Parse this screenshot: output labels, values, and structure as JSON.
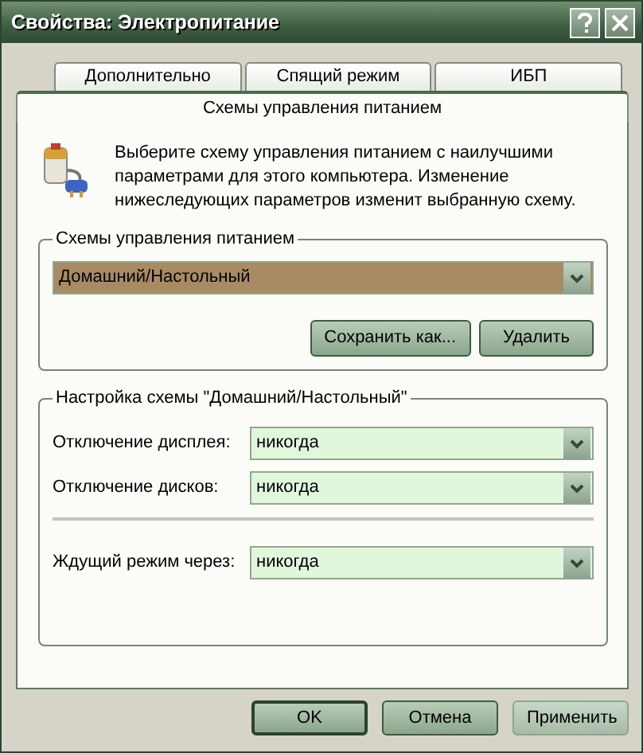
{
  "window": {
    "title": "Свойства: Электропитание",
    "buttons": [
      {
        "kind": "help"
      },
      {
        "kind": "close"
      }
    ]
  },
  "tab_rows": [
    [
      {
        "label": "Дополнительно",
        "selected": false
      },
      {
        "label": "Спящий режим",
        "selected": false
      },
      {
        "label": "ИБП",
        "selected": false
      }
    ],
    [
      {
        "label": "Схемы управления питанием",
        "selected": true
      }
    ]
  ],
  "intro": "Выберите схему управления питанием с наилучшими параметрами для этого компьютера. Изменение нижеследующих параметров изменит выбранную схему.",
  "schemes_group": {
    "title": "Схемы управления питанием",
    "dropdown": {
      "value": "Домашний/Настольный",
      "focused": true
    },
    "buttons": [
      "Сохранить как...",
      "Удалить"
    ]
  },
  "settings_group": {
    "title": "Настройка схемы \"Домашний/Настольный\"",
    "rows": [
      {
        "kind": "field",
        "label": "Отключение дисплея:",
        "value": "никогда"
      },
      {
        "kind": "field",
        "label": "Отключение дисков:",
        "value": "никогда"
      },
      {
        "kind": "separator"
      },
      {
        "kind": "field",
        "label": "Ждущий режим через:",
        "value": "никогда"
      }
    ]
  },
  "footer_buttons": [
    {
      "label": "OK",
      "default": true
    },
    {
      "label": "Отмена",
      "default": false
    },
    {
      "label": "Применить",
      "default": false
    }
  ]
}
